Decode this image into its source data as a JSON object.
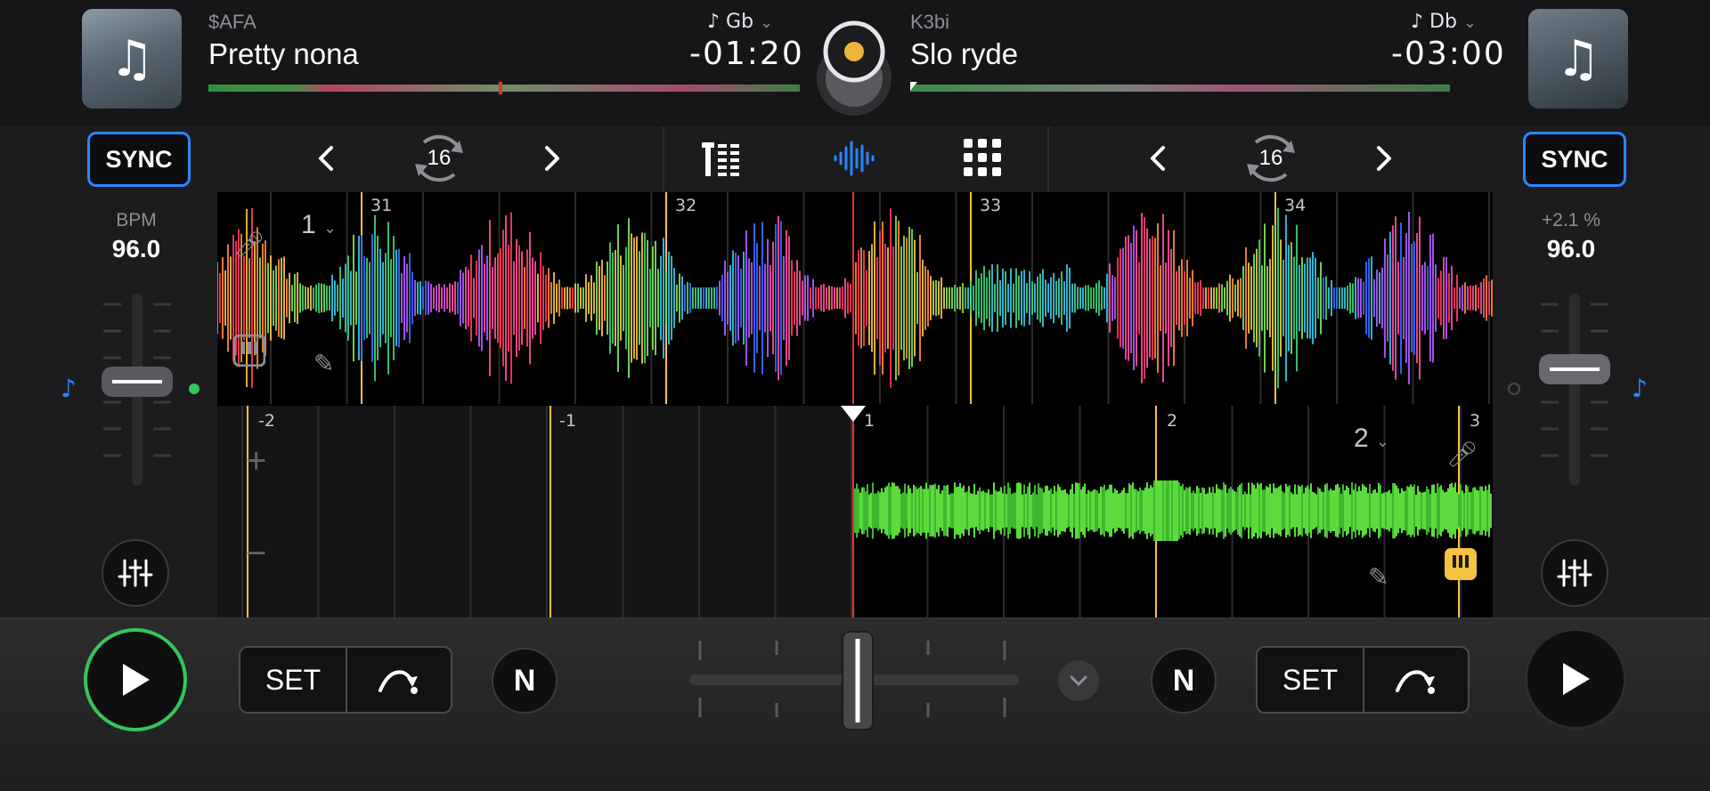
{
  "deck_a": {
    "artist": "$AFA",
    "title": "Pretty nona",
    "key": "Gb",
    "remaining_time": "-01:20",
    "sync_label": "SYNC",
    "bpm_label": "BPM",
    "bpm_value": "96.0",
    "loop_size": "16",
    "beatjump_marker": "1"
  },
  "deck_b": {
    "artist": "K3bi",
    "title": "Slo ryde",
    "key": "Db",
    "remaining_time": "-03:00",
    "sync_label": "SYNC",
    "pitch_label": "+2.1 %",
    "bpm_value": "96.0",
    "loop_size": "16",
    "beatjump_marker": "2"
  },
  "waveform_a_bars": [
    "31",
    "32",
    "33",
    "34"
  ],
  "waveform_b_bars": [
    "-2",
    "-1",
    "1",
    "2",
    "3"
  ],
  "bottom": {
    "set_label_a": "SET",
    "set_label_b": "SET",
    "n_label": "N"
  },
  "colors": {
    "accent_blue": "#2a86ff",
    "play_ring_green": "#34c759",
    "beat_line_yellow": "#f5c242",
    "playhead_red": "#e5352b",
    "jog_accent": "#f0b43c"
  },
  "icons": {
    "album_art": "music-note-icon",
    "key": "music-note-icon",
    "mixer": "sliders-icon",
    "loop": "loop-icon",
    "eq": "eq-icon",
    "waveform": "waveform-icon",
    "grid": "pads-grid-icon"
  }
}
